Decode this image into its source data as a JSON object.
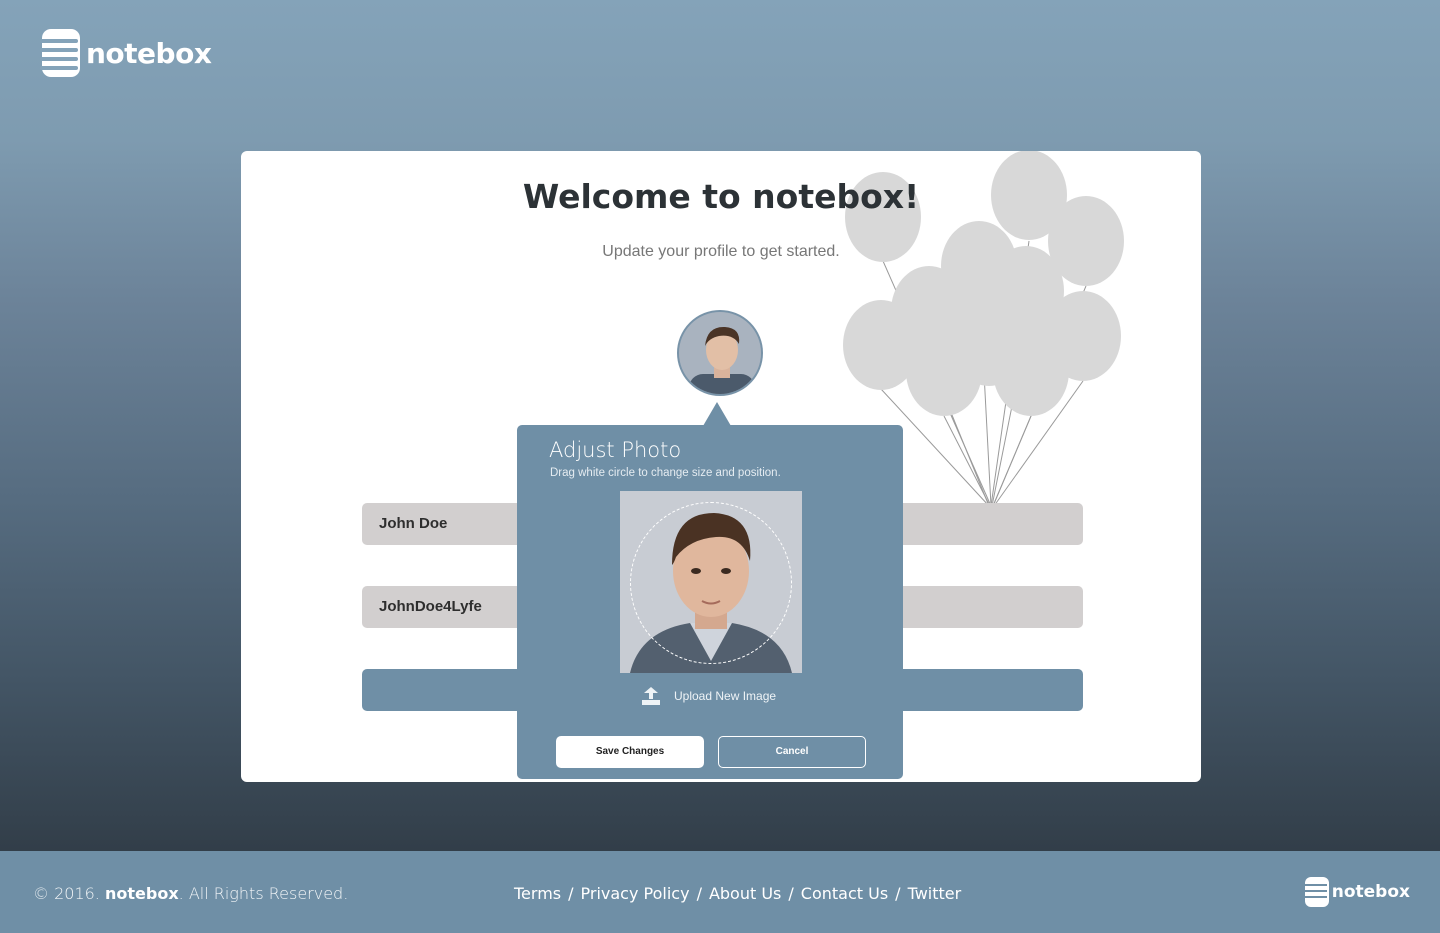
{
  "brand": {
    "name": "notebox"
  },
  "card": {
    "title": "Welcome to notebox!",
    "subtitle": "Update your profile to get started."
  },
  "form": {
    "name_value": "John Doe",
    "username_value": "JohnDoe4Lyfe"
  },
  "popup": {
    "title": "Adjust Photo",
    "hint": "Drag white circle to change size and position.",
    "upload_label": "Upload New Image",
    "save_label": "Save Changes",
    "cancel_label": "Cancel"
  },
  "footer": {
    "copyright_prefix": "© 2016.",
    "copyright_brand": "notebox",
    "copyright_suffix": ". All Rights Reserved.",
    "links": [
      "Terms",
      "Privacy Policy",
      "About Us",
      "Contact Us",
      "Twitter"
    ],
    "separator": "/"
  },
  "colors": {
    "accent": "#6f8fa6",
    "field_bg": "#d2cfcf",
    "balloon": "#d8d8d8"
  }
}
